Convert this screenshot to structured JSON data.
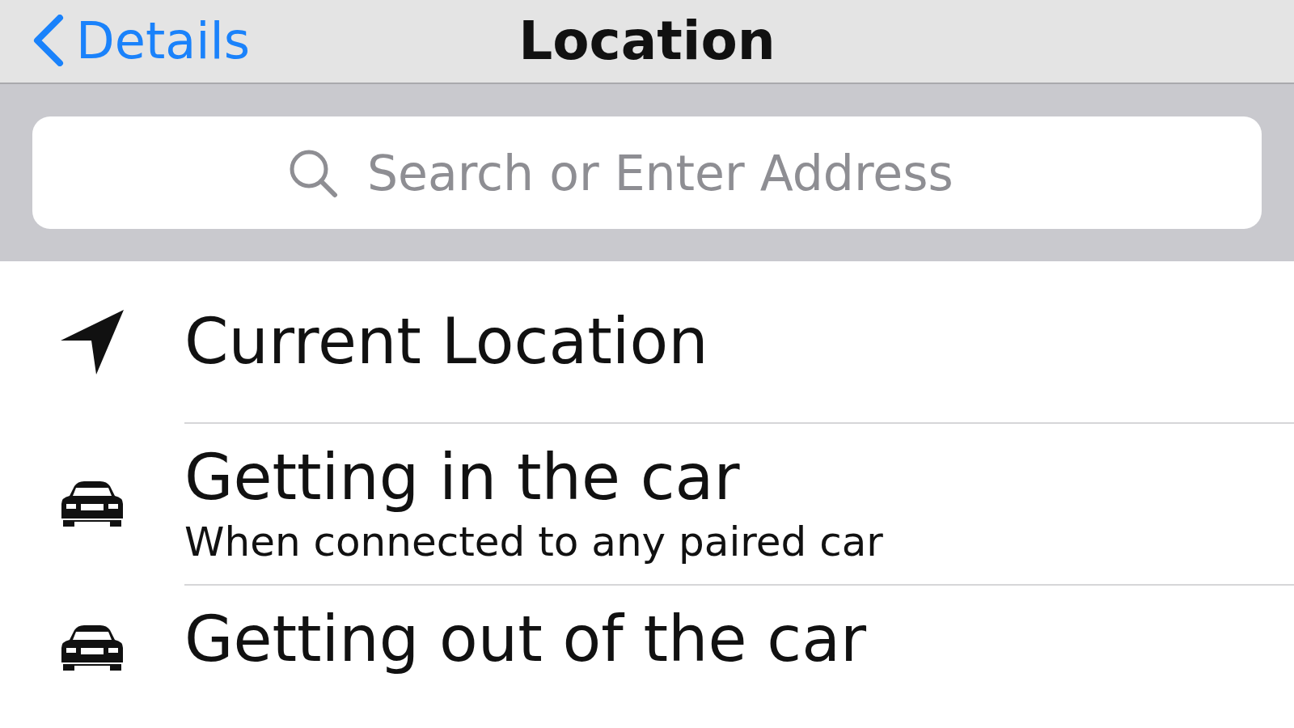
{
  "nav_bar": {
    "back_label": "Details",
    "title": "Location"
  },
  "search": {
    "placeholder": "Search or Enter Address"
  },
  "rows": [
    {
      "kind": "location",
      "title": "Current Location"
    },
    {
      "kind": "car",
      "title": "Getting in the car",
      "subtitle": "When connected to any paired car"
    },
    {
      "kind": "car",
      "title": "Getting out of the car"
    }
  ]
}
